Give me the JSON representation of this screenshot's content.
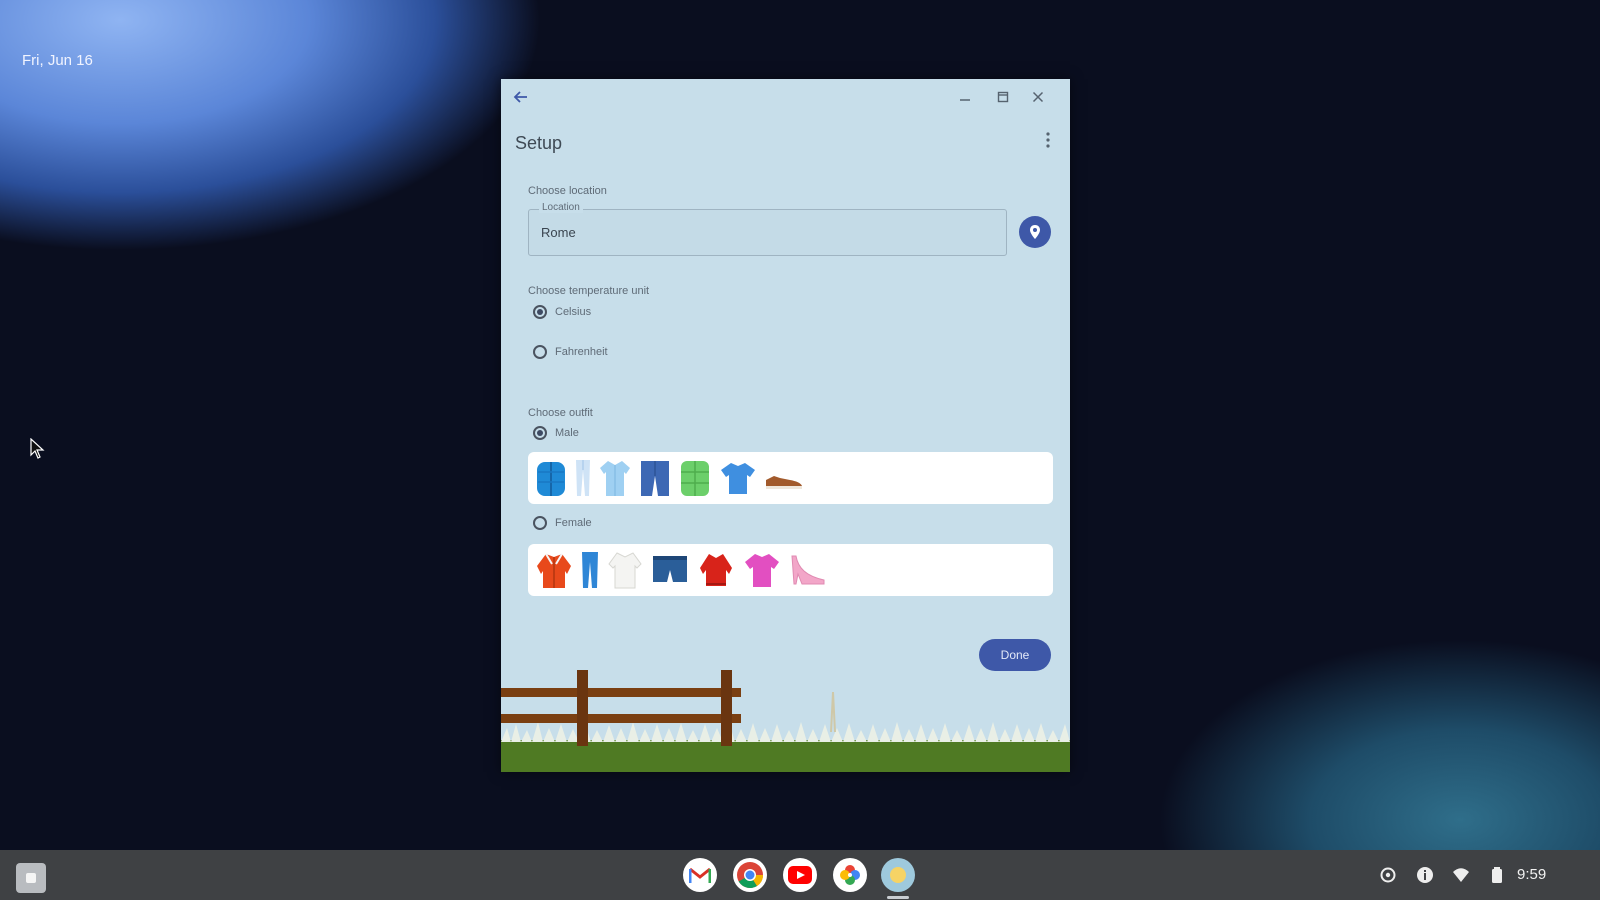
{
  "desktop": {
    "date": "Fri, Jun 16"
  },
  "window": {
    "title": "Setup",
    "location_section_label": "Choose location",
    "location_field": {
      "label": "Location",
      "value": "Rome"
    },
    "temperature_section_label": "Choose temperature unit",
    "temperature_options": [
      {
        "label": "Celsius",
        "checked": true
      },
      {
        "label": "Fahrenheit",
        "checked": false
      }
    ],
    "outfit_section_label": "Choose outfit",
    "outfit_options": [
      {
        "label": "Male",
        "checked": true,
        "items": [
          "puffer-jacket-icon",
          "jeans-icon",
          "shirt-icon",
          "shorts-icon",
          "vest-icon",
          "tshirt-icon",
          "shoe-icon"
        ]
      },
      {
        "label": "Female",
        "checked": false,
        "items": [
          "jacket-icon",
          "jeans-icon",
          "blouse-icon",
          "shorts-icon",
          "sweater-icon",
          "tshirt-icon",
          "heel-icon"
        ]
      }
    ],
    "done_label": "Done"
  },
  "shelf": {
    "apps": [
      "gmail-icon",
      "chrome-icon",
      "youtube-icon",
      "photos-icon",
      "weather-app-icon"
    ],
    "time": "9:59"
  }
}
